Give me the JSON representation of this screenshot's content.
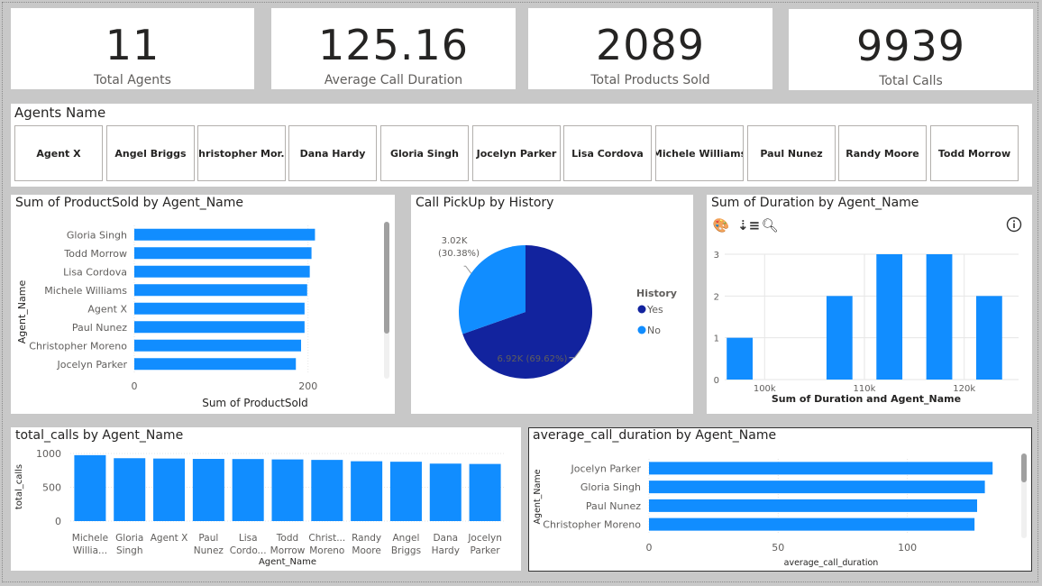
{
  "kpis": [
    {
      "value": "11",
      "label": "Total Agents"
    },
    {
      "value": "125.16",
      "label": "Average Call Duration"
    },
    {
      "value": "2089",
      "label": "Total Products Sold"
    },
    {
      "value": "9939",
      "label": "Total Calls"
    }
  ],
  "slicer": {
    "title": "Agents Name",
    "items": [
      "Agent X",
      "Angel Briggs",
      "Christopher Mor...",
      "Dana Hardy",
      "Gloria Singh",
      "Jocelyn Parker",
      "Lisa Cordova",
      "Michele Williams",
      "Paul Nunez",
      "Randy Moore",
      "Todd Morrow"
    ]
  },
  "colors": {
    "accent": "#118dff",
    "dark": "#12239e",
    "grid": "#e6e6e6"
  },
  "icons": [
    "palette-icon",
    "sort-icon",
    "zoom-icon",
    "info-icon"
  ],
  "chart_data": [
    {
      "type": "bar",
      "orientation": "horizontal",
      "title": "Sum of ProductSold by Agent_Name",
      "ylabel": "Agent_Name",
      "xlabel": "Sum of ProductSold",
      "categories": [
        "Gloria Singh",
        "Todd Morrow",
        "Lisa Cordova",
        "Michele Williams",
        "Agent X",
        "Paul Nunez",
        "Christopher Moreno",
        "Jocelyn Parker"
      ],
      "values": [
        208,
        204,
        202,
        199,
        196,
        196,
        192,
        186
      ],
      "xlim": [
        0,
        220
      ],
      "xticks": [
        0,
        200
      ],
      "xtick_labels": [
        "0",
        "200"
      ]
    },
    {
      "type": "pie",
      "title": "Call PickUp by History",
      "legend_title": "History",
      "legend_position": "right",
      "slices": [
        {
          "name": "Yes",
          "value": 6920,
          "label": "6.92K (69.62%)",
          "color": "#12239e"
        },
        {
          "name": "No",
          "value": 3020,
          "label": "3.02K (30.38%)",
          "color": "#118dff"
        }
      ]
    },
    {
      "type": "bar",
      "title": "Sum of Duration by Agent_Name",
      "xlabel": "Sum of Duration and Agent_Name",
      "x_bins": [
        97.5,
        102.5,
        107.5,
        112.5,
        117.5,
        122.5
      ],
      "values": [
        1,
        0,
        2,
        3,
        3,
        2
      ],
      "xlim": [
        96,
        124
      ],
      "ylim": [
        0,
        3
      ],
      "yticks": [
        0,
        1,
        2,
        3
      ],
      "xticks": [
        100,
        110,
        120
      ],
      "xtick_labels": [
        "100k",
        "110k",
        "120k"
      ]
    },
    {
      "type": "bar",
      "title": "total_calls by Agent_Name",
      "xlabel": "Agent_Name",
      "ylabel": "total_calls",
      "categories": [
        [
          "Michele",
          "Willia..."
        ],
        [
          "Gloria",
          "Singh"
        ],
        [
          "Agent X"
        ],
        [
          "Paul",
          "Nunez"
        ],
        [
          "Lisa",
          "Cordo..."
        ],
        [
          "Todd",
          "Morrow"
        ],
        [
          "Christ...",
          "Moreno"
        ],
        [
          "Randy",
          "Moore"
        ],
        [
          "Angel",
          "Briggs"
        ],
        [
          "Dana",
          "Hardy"
        ],
        [
          "Jocelyn",
          "Parker"
        ]
      ],
      "values": [
        975,
        930,
        925,
        920,
        918,
        912,
        905,
        885,
        878,
        850,
        845
      ],
      "ylim": [
        0,
        1000
      ],
      "yticks": [
        0,
        500,
        1000
      ]
    },
    {
      "type": "bar",
      "orientation": "horizontal",
      "title": "average_call_duration by Agent_Name",
      "ylabel": "Agent_Name",
      "xlabel": "average_call_duration",
      "categories": [
        "Jocelyn Parker",
        "Gloria Singh",
        "Paul Nunez",
        "Christopher Moreno"
      ],
      "values": [
        133,
        130,
        127,
        126
      ],
      "xlim": [
        0,
        142
      ],
      "xticks": [
        0,
        50,
        100
      ]
    }
  ]
}
